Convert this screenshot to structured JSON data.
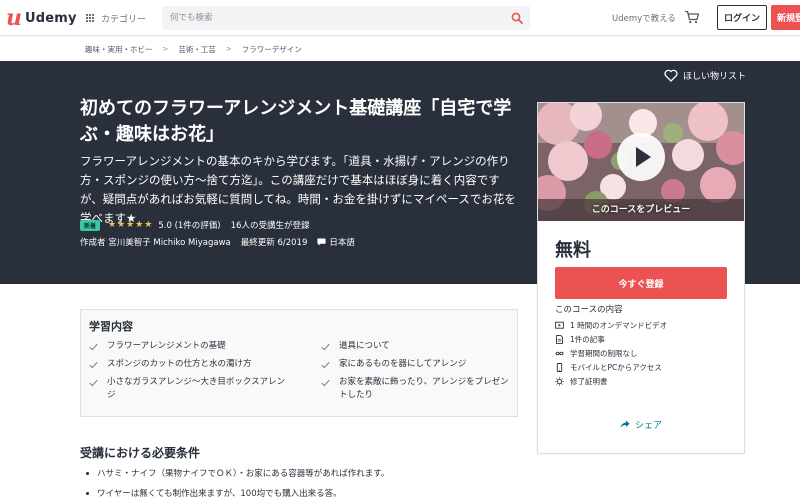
{
  "header": {
    "logo_text": "Udemy",
    "categories_label": "カテゴリー",
    "search_placeholder": "何でも検索",
    "teach_label": "Udemyで教える",
    "login_label": "ログイン",
    "signup_label": "新規登"
  },
  "breadcrumb": [
    "趣味・実用・ホビー",
    "芸術・工芸",
    "フラワーデザイン"
  ],
  "hero": {
    "wishlist_label": "ほしい物リスト",
    "title": "初めてのフラワーアレンジメント基礎講座「自宅で学ぶ・趣味はお花」",
    "subtitle": "フラワーアレンジメントの基本のキから学びます。「道具・水揚げ・アレンジの作り方・スポンジの使い方〜捨て方迄」。この講座だけで基本はほぼ身に着く内容ですが、疑問点があればお気軽に質問してね。時間・お金を掛けずにマイペースでお花を学べます★",
    "badge": "新着",
    "stars": "★★★★★",
    "rating": "5.0 (1件の評価)",
    "students": "16人の受講生が登録",
    "author": "作成者 宮川美智子 Michiko Miyagawa",
    "updated": "最終更新 6/2019",
    "language": "日本語"
  },
  "card": {
    "preview_label": "このコースをプレビュー",
    "price": "無料",
    "enroll_label": "今すぐ登録",
    "includes_title": "このコースの内容",
    "includes": [
      {
        "icon": "video-icon",
        "text": "1 時間のオンデマンドビデオ"
      },
      {
        "icon": "article-icon",
        "text": "1件の記事"
      },
      {
        "icon": "infinity-icon",
        "text": "学習期間の制限なし"
      },
      {
        "icon": "mobile-icon",
        "text": "モバイルとPCからアクセス"
      },
      {
        "icon": "certificate-icon",
        "text": "修了証明書"
      }
    ],
    "share_label": "シェア"
  },
  "learn": {
    "title": "学習内容",
    "items": [
      "フラワーアレンジメントの基礎",
      "道具について",
      "スポンジのカットの仕方と水の濁け方",
      "家にあるものを器にしてアレンジ",
      "小さなガラスアレンジ〜大き目ボックスアレンジ",
      "お家を素敵に飾ったり、アレンジをプレゼントしたり"
    ]
  },
  "requirements": {
    "title": "受講における必要条件",
    "items": [
      "ハサミ・ナイフ（果物ナイフでＯＫ）・お家にある容器等があれば作れます。",
      "ワイヤーは無くても制作出来ますが、100均でも購入出来る答。"
    ]
  },
  "colors": {
    "brand": "#ec5252",
    "hero_bg": "#29303b",
    "star": "#f4c150",
    "badge": "#3ac7a4",
    "link": "#007791"
  }
}
